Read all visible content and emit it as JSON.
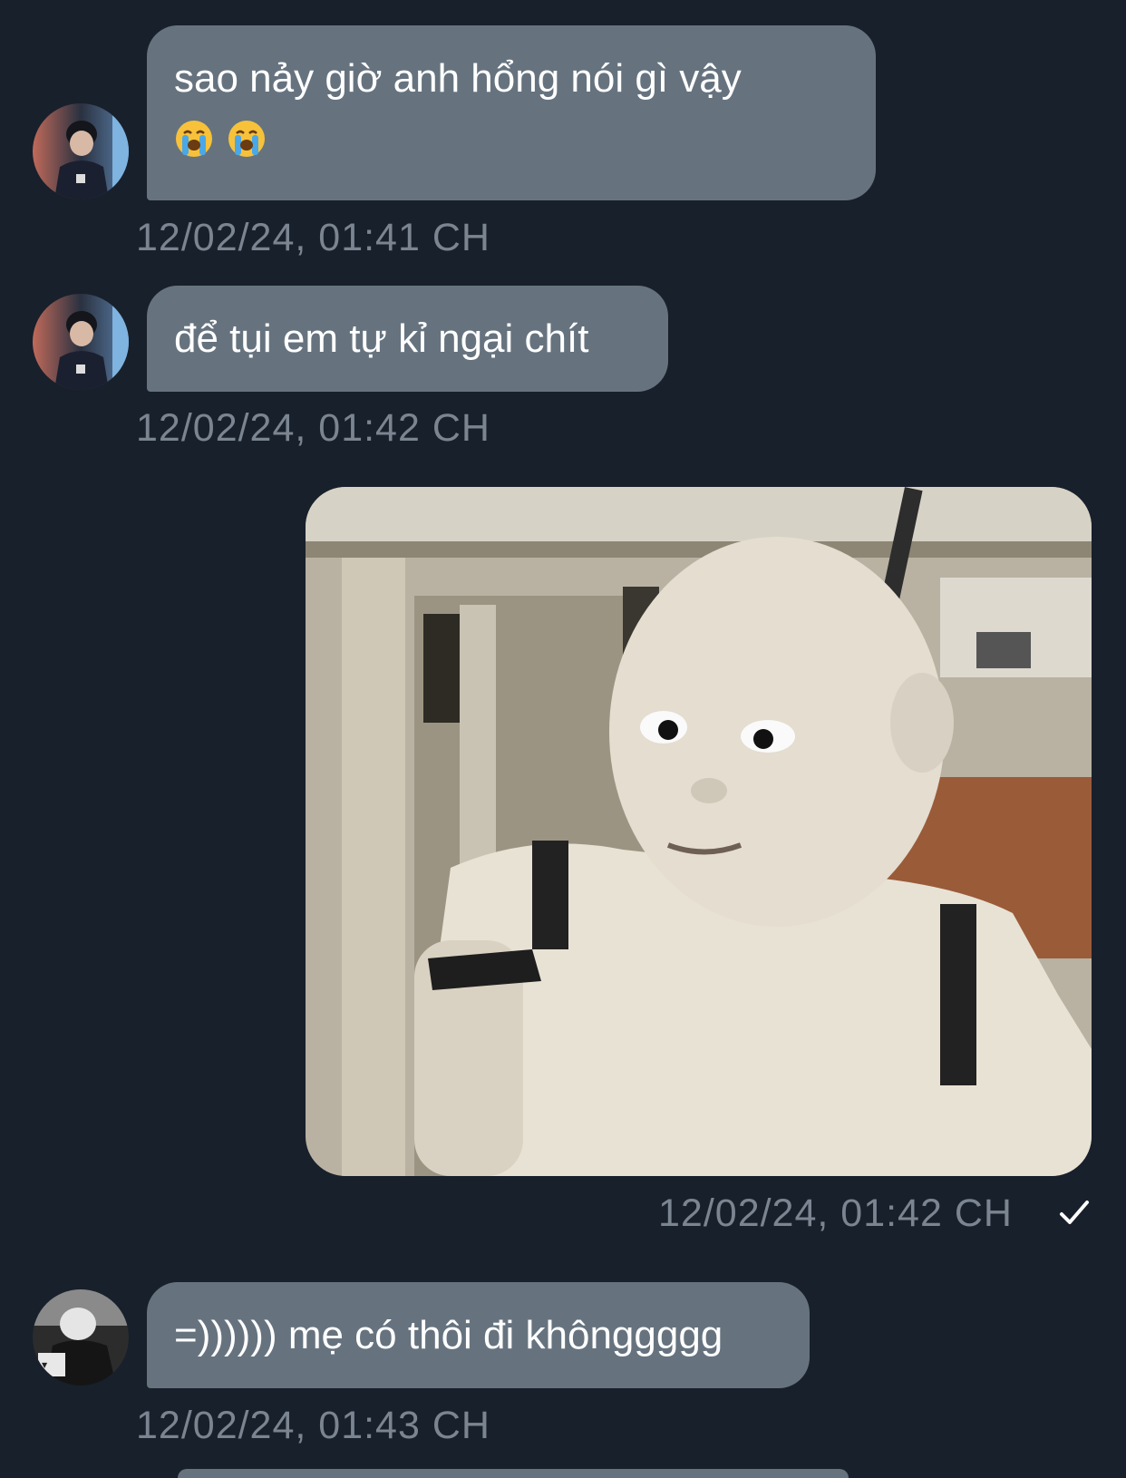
{
  "messages": [
    {
      "direction": "incoming",
      "text": "sao nảy giờ anh hổng nói gì vậy",
      "emojis": [
        "loudly-crying-face",
        "loudly-crying-face"
      ],
      "timestamp": "12/02/24, 01:41 CH",
      "avatar": "contact-avatar"
    },
    {
      "direction": "incoming",
      "text": "để tụi em tự kỉ ngại chít",
      "timestamp": "12/02/24, 01:42 CH",
      "avatar": "contact-avatar"
    },
    {
      "direction": "outgoing",
      "type": "image",
      "image_description_icon": "photo-attachment",
      "timestamp": "12/02/24, 01:42 CH",
      "status_icon": "check-icon"
    },
    {
      "direction": "incoming",
      "text": "=)))))) mẹ có thôi đi khônggggg",
      "timestamp": "12/02/24, 01:43 CH",
      "avatar": "contact-avatar-2"
    }
  ],
  "colors": {
    "background": "#18202b",
    "bubble": "#66737f",
    "timestamp": "#7b8591",
    "text": "#ffffff"
  }
}
